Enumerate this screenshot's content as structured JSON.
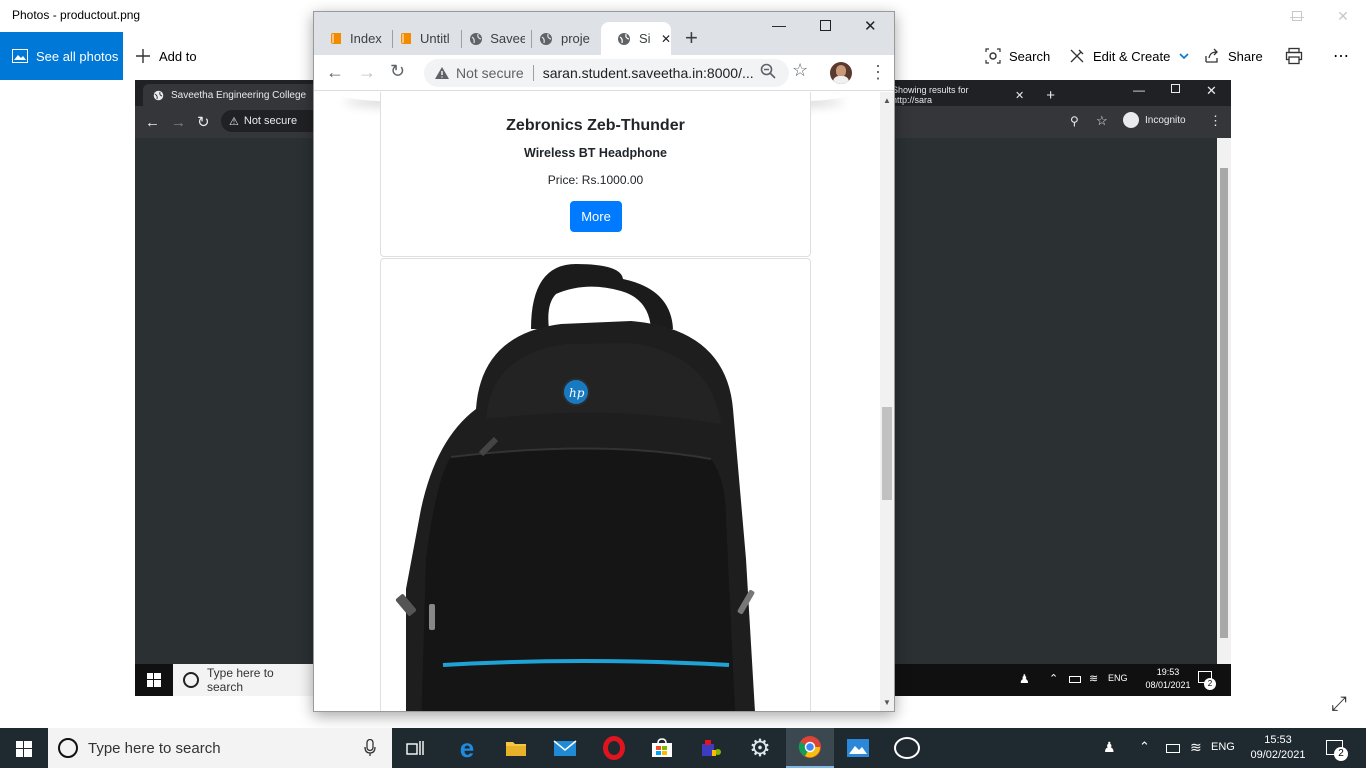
{
  "photos": {
    "title": "Photos - productout.png",
    "see_all": "See all photos",
    "add_to": "Add to",
    "search": "Search",
    "edit_create": "Edit & Create",
    "share": "Share"
  },
  "inner": {
    "tab_title": "Saveetha Engineering College",
    "tab_right_title": "Showing results for http://sara",
    "not_secure": "Not secure",
    "incognito": "Incognito",
    "search_placeholder": "Type here to search",
    "lang": "ENG",
    "time": "19:53",
    "date": "08/01/2021",
    "notif_count": "2"
  },
  "chrome": {
    "tabs": [
      {
        "label": "Index"
      },
      {
        "label": "Untitl"
      },
      {
        "label": "Savee"
      },
      {
        "label": "proje"
      },
      {
        "label": "Si"
      }
    ],
    "not_secure": "Not secure",
    "url": "saran.student.saveetha.in:8000/..."
  },
  "product": {
    "name": "Zebronics Zeb-Thunder",
    "subtitle": "Wireless BT Headphone",
    "price": "Price: Rs.1000.00",
    "more_label": "More"
  },
  "taskbar": {
    "search_placeholder": "Type here to search",
    "lang": "ENG",
    "time": "15:53",
    "date": "09/02/2021",
    "notif_count": "2"
  },
  "colors": {
    "accent": "#0078d7",
    "button": "#007bff",
    "taskbar": "#1f2a30"
  }
}
